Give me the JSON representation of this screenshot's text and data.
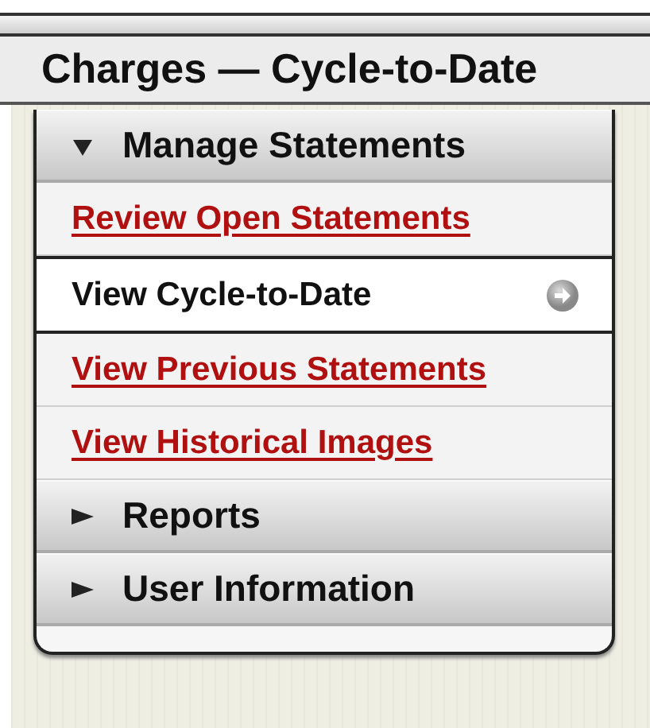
{
  "title": "Charges — Cycle-to-Date",
  "sections": [
    {
      "label": "Manage Statements",
      "expanded": true,
      "items": [
        {
          "label": "Review Open Statements",
          "selected": false
        },
        {
          "label": "View Cycle-to-Date",
          "selected": true
        },
        {
          "label": "View Previous Statements",
          "selected": false
        },
        {
          "label": "View Historical Images",
          "selected": false
        }
      ]
    },
    {
      "label": "Reports",
      "expanded": false
    },
    {
      "label": "User Information",
      "expanded": false
    }
  ]
}
